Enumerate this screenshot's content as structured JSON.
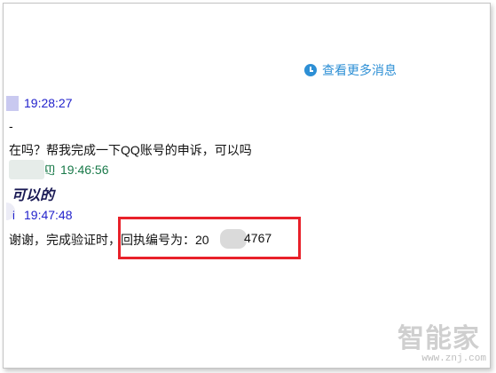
{
  "history_link": {
    "label": "查看更多消息",
    "icon": "clock-icon",
    "color": "#2d8fd5"
  },
  "messages": [
    {
      "time": "19:28:27",
      "time_color": "#2222cc",
      "lines": [
        "-",
        "在吗？帮我完成一下QQ账号的申诉，可以吗"
      ]
    },
    {
      "name_tail": "ញ",
      "time": "19:46:56",
      "time_color": "#1a7a4a",
      "lines": [
        "可以的"
      ]
    },
    {
      "name_tail": "i",
      "time": "19:47:48",
      "time_color": "#2222cc",
      "lines": [
        "谢谢，完成验证时，回执编号为：20",
        "4767"
      ]
    }
  ],
  "annotation": {
    "color": "#e8212a"
  },
  "watermark": {
    "text": "智能家",
    "url": "www.znj.com"
  }
}
